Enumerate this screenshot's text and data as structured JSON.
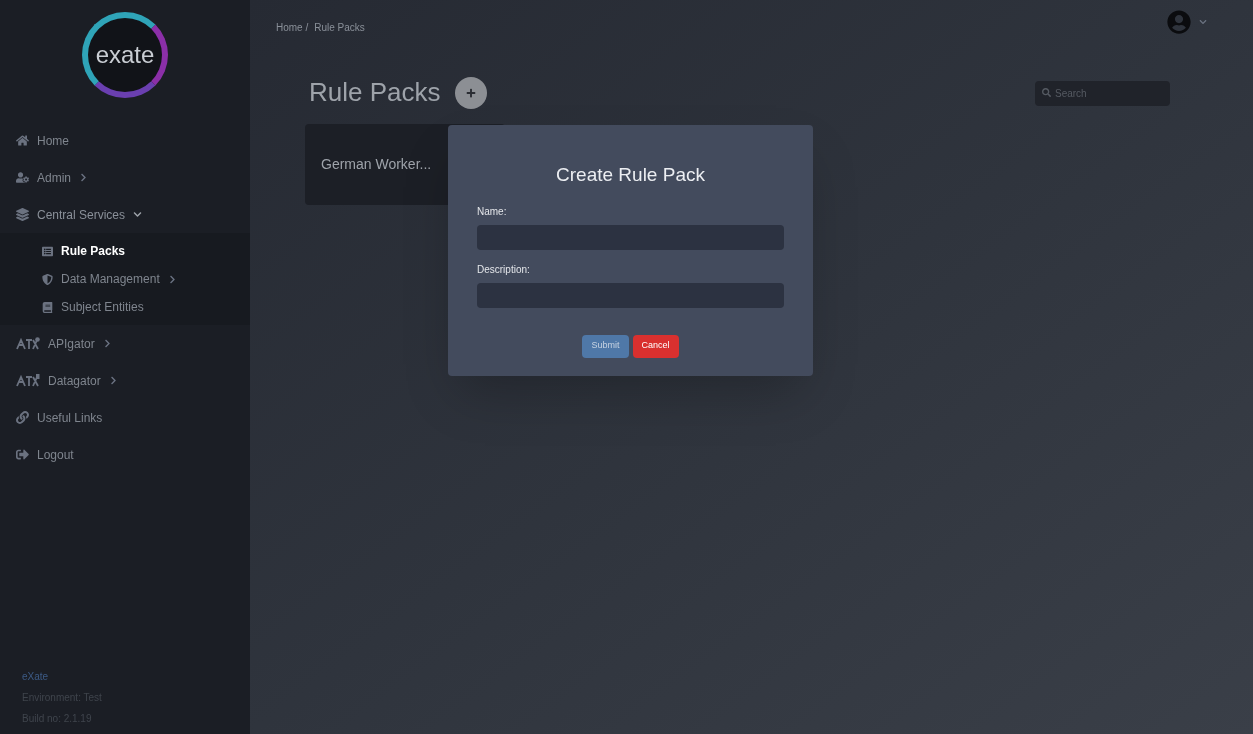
{
  "sidebar": {
    "logo_text": "exate",
    "items": [
      {
        "label": "Home",
        "submenu": false,
        "selected": false
      },
      {
        "label": "Admin",
        "submenu": true,
        "expanded": false,
        "selected": false
      },
      {
        "label": "Central Services",
        "submenu": true,
        "expanded": true,
        "selected": false,
        "children": [
          {
            "label": "Rule Packs",
            "submenu": false,
            "selected": true
          },
          {
            "label": "Data Management",
            "submenu": true,
            "expanded": false,
            "selected": false
          },
          {
            "label": "Subject Entities",
            "submenu": false,
            "selected": false
          }
        ]
      },
      {
        "label": "APIgator",
        "submenu": true,
        "expanded": false,
        "selected": false
      },
      {
        "label": "Datagator",
        "submenu": true,
        "expanded": false,
        "selected": false
      },
      {
        "label": "Useful Links",
        "submenu": false,
        "selected": false
      },
      {
        "label": "Logout",
        "submenu": false,
        "selected": false
      }
    ],
    "footer": {
      "link": "eXate",
      "environment": "Environment: Test",
      "build": "Build no: 2.1.19"
    }
  },
  "breadcrumb": [
    "Home /",
    "Rule Packs"
  ],
  "page_title": "Rule Packs",
  "search": {
    "placeholder": "Search"
  },
  "cards": [
    {
      "title": "German Worker..."
    }
  ],
  "dialog": {
    "title": "Create Rule Pack",
    "fields": [
      {
        "label": "Name:"
      },
      {
        "label": "Description:"
      }
    ],
    "buttons": [
      {
        "label": "Submit",
        "kind": "primary"
      },
      {
        "label": "Cancel",
        "kind": "danger"
      }
    ]
  }
}
